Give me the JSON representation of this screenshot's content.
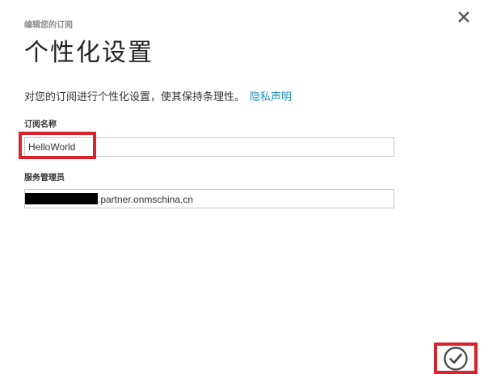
{
  "dialog": {
    "subtitle": "编辑您的订阅",
    "title": "个性化设置",
    "description": "对您的订阅进行个性化设置，使其保持条理性。",
    "privacy_link": "隐私声明"
  },
  "fields": {
    "subscription_name": {
      "label": "订阅名称",
      "value": "HelloWorld"
    },
    "service_admin": {
      "label": "服务管理员",
      "value_suffix": ".partner.onmschina.cn"
    }
  },
  "icons": {
    "close": "close-icon",
    "confirm": "checkmark-icon"
  },
  "colors": {
    "link": "#1c8fb9",
    "highlight": "#d7232b"
  }
}
